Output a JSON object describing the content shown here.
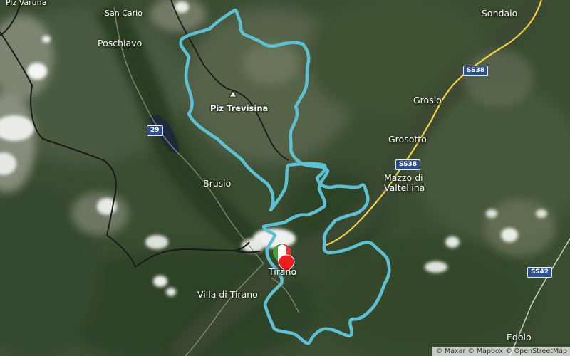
{
  "map": {
    "places": [
      {
        "id": "piz-varuna",
        "name": "Piz Varuna"
      },
      {
        "id": "san-carlo",
        "name": "San Carlo"
      },
      {
        "id": "poschiavo",
        "name": "Poschiavo"
      },
      {
        "id": "sondalo",
        "name": "Sondalo"
      },
      {
        "id": "piz-trevisina",
        "name": "Piz Trevisina"
      },
      {
        "id": "grosio",
        "name": "Grosio"
      },
      {
        "id": "grosotto",
        "name": "Grosotto"
      },
      {
        "id": "mazzo-di-valtellina",
        "name": "Mazzo di\nValtellina"
      },
      {
        "id": "brusio",
        "name": "Brusio"
      },
      {
        "id": "tirano",
        "name": "Tirano"
      },
      {
        "id": "villa-di-tirano",
        "name": "Villa di Tirano"
      },
      {
        "id": "edolo",
        "name": "Edolo"
      }
    ],
    "road_shields": [
      {
        "id": "ss38-north",
        "label": "SS38"
      },
      {
        "id": "29",
        "label": "29"
      },
      {
        "id": "ss38-south",
        "label": "SS38"
      },
      {
        "id": "ss42",
        "label": "SS42"
      }
    ],
    "route_color": "#5fc0d3",
    "border_color": "#1a1a1a",
    "highway_color": "#f2cf45",
    "start_marker_colors": [
      "#3aa935",
      "#ffffff",
      "#e53535"
    ],
    "end_marker_color": "#ee1c1c"
  },
  "attribution": {
    "maxar": "© Maxar",
    "mapbox": "© Mapbox",
    "osm": "© OpenStreetMap"
  }
}
